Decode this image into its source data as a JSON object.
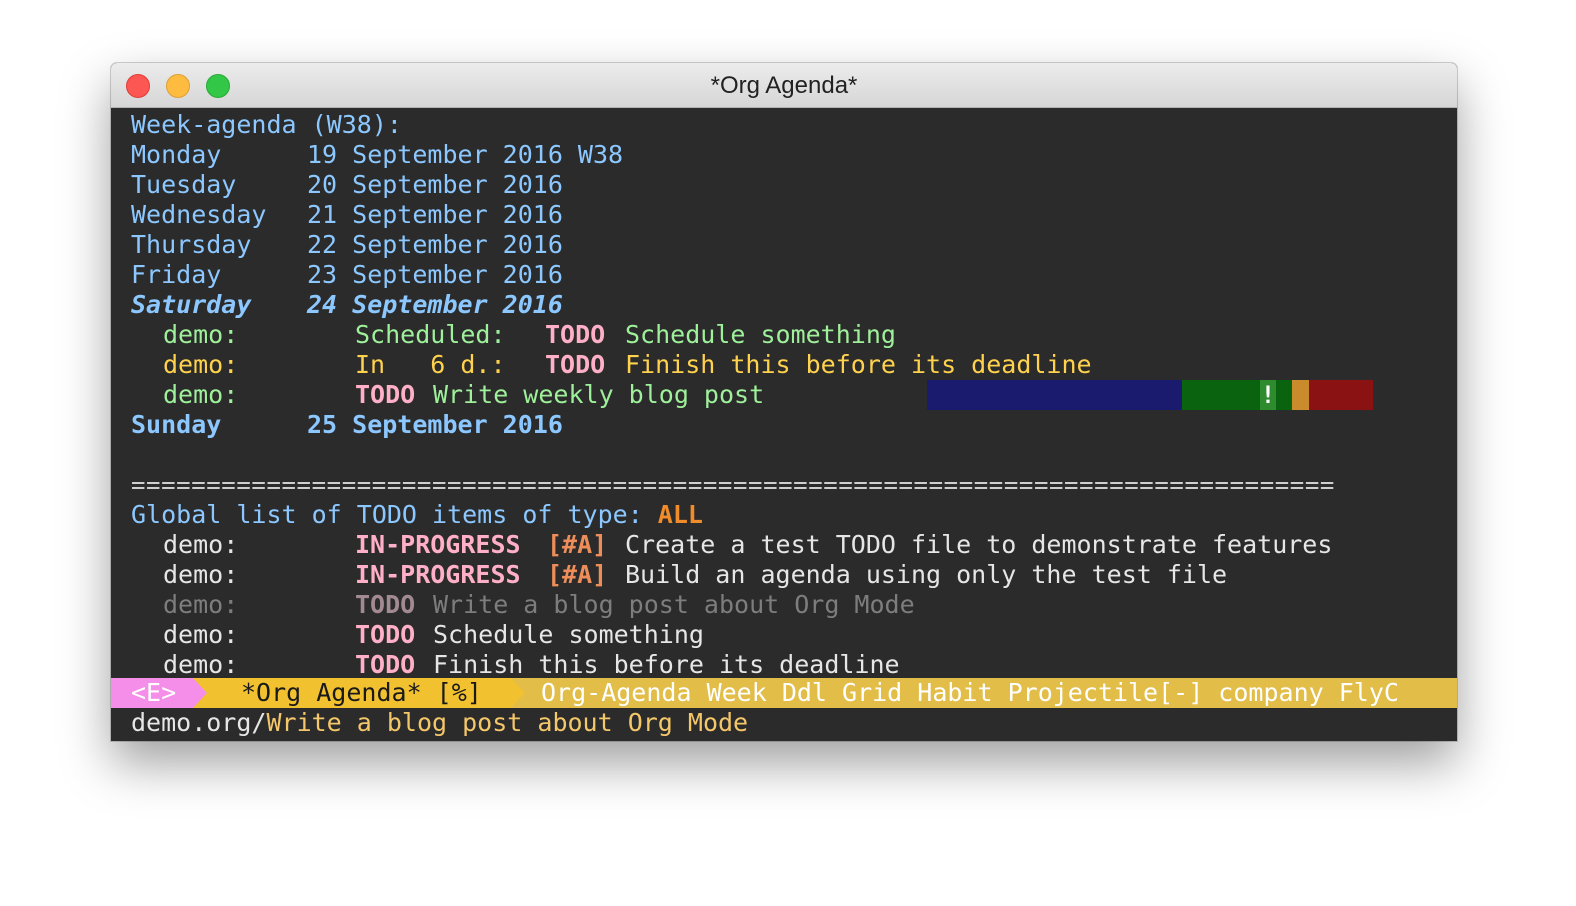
{
  "window": {
    "title": "*Org Agenda*"
  },
  "agenda": {
    "header": "Week-agenda (W38):",
    "days": [
      {
        "name": "Monday",
        "date": "19 September 2016 W38"
      },
      {
        "name": "Tuesday",
        "date": "20 September 2016"
      },
      {
        "name": "Wednesday",
        "date": "21 September 2016"
      },
      {
        "name": "Thursday",
        "date": "22 September 2016"
      },
      {
        "name": "Friday",
        "date": "23 September 2016"
      },
      {
        "name": "Saturday",
        "date": "24 September 2016"
      },
      {
        "name": "Sunday",
        "date": "25 September 2016"
      }
    ],
    "saturday_items": [
      {
        "category": "demo:",
        "prefix": "Scheduled:",
        "keyword": "TODO",
        "text": "Schedule something"
      },
      {
        "category": "demo:",
        "prefix": "In   6 d.:",
        "keyword": "TODO",
        "text": "Finish this before its deadline"
      },
      {
        "category": "demo:",
        "prefix": "",
        "keyword": "TODO",
        "text": "Write weekly blog post"
      }
    ],
    "habit_graph": {
      "colors": [
        "#1a1a6e",
        "#0a640f",
        "#2e8b2e",
        "#0a640f",
        "#c98b2b",
        "#8a1212"
      ],
      "mark": "!"
    }
  },
  "separator": "================================================================================",
  "global": {
    "header_prefix": "Global list of TODO items of type: ",
    "header_type": "ALL",
    "items": [
      {
        "category": "demo:",
        "keyword": "IN-PROGRESS",
        "priority": "[#A]",
        "text": "Create a test TODO file to demonstrate features"
      },
      {
        "category": "demo:",
        "keyword": "IN-PROGRESS",
        "priority": "[#A]",
        "text": "Build an agenda using only the test file"
      },
      {
        "category": "demo:",
        "keyword": "TODO",
        "priority": "",
        "text": "Write a blog post about Org Mode"
      },
      {
        "category": "demo:",
        "keyword": "TODO",
        "priority": "",
        "text": "Schedule something"
      },
      {
        "category": "demo:",
        "keyword": "TODO",
        "priority": "",
        "text": "Finish this before its deadline"
      }
    ]
  },
  "modeline": {
    "state": "<E>",
    "buffer": "*Org Agenda* [%]",
    "modes": "Org-Agenda Week Ddl Grid Habit Projectile[-] company FlyC"
  },
  "echo": {
    "path": "demo.org/",
    "heading": "Write a blog post about Org Mode"
  }
}
